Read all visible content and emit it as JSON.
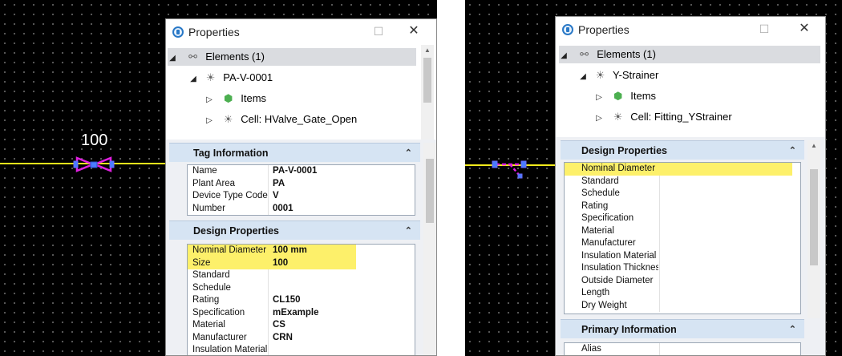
{
  "left": {
    "valve_label": "100",
    "panel": {
      "title": "Properties",
      "controls": {
        "minimize": "—",
        "maximize": "☐",
        "close": "✕"
      },
      "tree": [
        {
          "arrow": "◢",
          "icon": "⚯",
          "label": "Elements (1)",
          "selected": true
        },
        {
          "arrow": "◢",
          "icon": "☀",
          "label": "PA-V-0001"
        },
        {
          "arrow": "▷",
          "icon": "⬢",
          "label": "Items"
        },
        {
          "arrow": "▷",
          "icon": "☀",
          "label": "Cell: HValve_Gate_Open"
        }
      ],
      "tag_section": {
        "title": "Tag Information",
        "rows": [
          {
            "key": "Name",
            "value": "PA-V-0001"
          },
          {
            "key": "Plant Area",
            "value": "PA"
          },
          {
            "key": "Device Type Code",
            "value": "V"
          },
          {
            "key": "Number",
            "value": "0001"
          }
        ]
      },
      "design_section": {
        "title": "Design Properties",
        "rows": [
          {
            "key": "Nominal Diameter",
            "value": "100 mm"
          },
          {
            "key": "Size",
            "value": "100"
          },
          {
            "key": "Standard",
            "value": ""
          },
          {
            "key": "Schedule",
            "value": ""
          },
          {
            "key": "Rating",
            "value": "CL150"
          },
          {
            "key": "Specification",
            "value": "mExample"
          },
          {
            "key": "Material",
            "value": "CS"
          },
          {
            "key": "Manufacturer",
            "value": "CRN"
          },
          {
            "key": "Insulation Material",
            "value": ""
          }
        ]
      }
    }
  },
  "right": {
    "panel": {
      "title": "Properties",
      "controls": {
        "minimize": "—",
        "maximize": "☐",
        "close": "✕"
      },
      "tree": [
        {
          "arrow": "◢",
          "icon": "⚯",
          "label": "Elements (1)",
          "selected": true
        },
        {
          "arrow": "◢",
          "icon": "☀",
          "label": "Y-Strainer"
        },
        {
          "arrow": "▷",
          "icon": "⬢",
          "label": "Items"
        },
        {
          "arrow": "▷",
          "icon": "☀",
          "label": "Cell: Fitting_YStrainer"
        }
      ],
      "design_section": {
        "title": "Design Properties",
        "rows": [
          {
            "key": "Nominal Diameter",
            "value": ""
          },
          {
            "key": "Standard",
            "value": ""
          },
          {
            "key": "Schedule",
            "value": ""
          },
          {
            "key": "Rating",
            "value": ""
          },
          {
            "key": "Specification",
            "value": ""
          },
          {
            "key": "Material",
            "value": ""
          },
          {
            "key": "Manufacturer",
            "value": ""
          },
          {
            "key": "Insulation Material",
            "value": ""
          },
          {
            "key": "Insulation Thicknes",
            "value": ""
          },
          {
            "key": "Outside Diameter",
            "value": ""
          },
          {
            "key": "Length",
            "value": ""
          },
          {
            "key": "Dry Weight",
            "value": ""
          }
        ]
      },
      "primary_section": {
        "title": "Primary Information",
        "rows": [
          {
            "key": "Alias",
            "value": ""
          }
        ]
      }
    }
  },
  "colors": {
    "pipe": "#f2ea1c",
    "symbol": "#e020e0",
    "highlight": "#fdf06a",
    "section_header": "#d6e4f3"
  },
  "chevron_up": "⌃"
}
